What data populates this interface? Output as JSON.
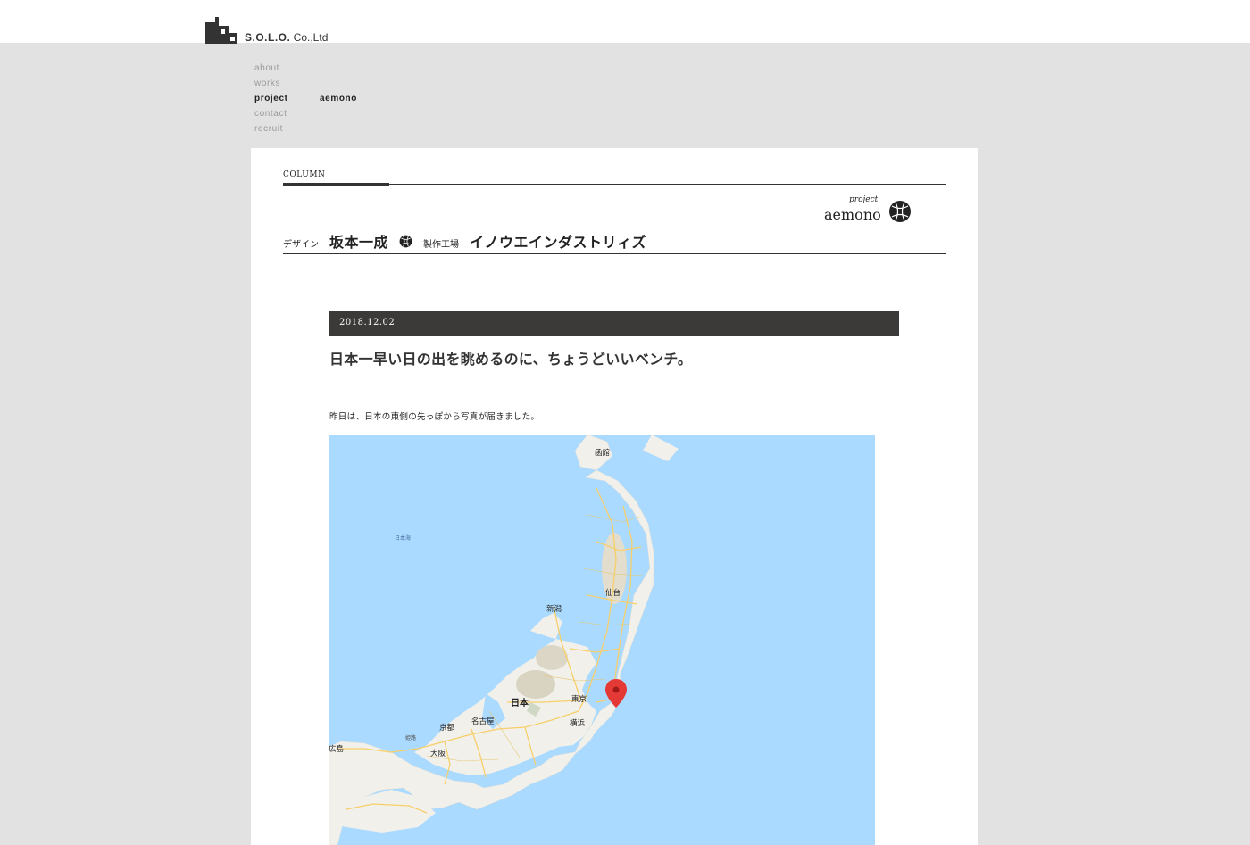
{
  "header": {
    "logo_text_bold": "S.O.L.O.",
    "logo_text_rest": " Co.,Ltd"
  },
  "nav": {
    "items": [
      {
        "label": "about"
      },
      {
        "label": "works"
      },
      {
        "label": "project"
      },
      {
        "label": "contact"
      },
      {
        "label": "recruit"
      }
    ],
    "active": "project",
    "sub_item": "aemono"
  },
  "column": {
    "label": "COLUMN",
    "brand_project": "project",
    "brand_name": "aemono",
    "design_label": "デザイン",
    "designer": "坂本一成",
    "factory_label": "製作工場",
    "factory": "イノウエインダストリィズ"
  },
  "post": {
    "date": "2018.12.02",
    "title": "日本一早い日の出を眺めるのに、ちょうどいいベンチ。",
    "body": "昨日は、日本の東側の先っぽから写真が届きました。"
  },
  "map": {
    "labels": {
      "hakodate": "函館",
      "sea_of_japan": "日本海",
      "sendai": "仙台",
      "niigata": "新潟",
      "japan": "日本",
      "tokyo": "東京",
      "yokohama": "横浜",
      "nagoya": "名古屋",
      "kyoto": "京都",
      "osaka": "大阪",
      "hiroshima": "広島",
      "himeji": "姫路"
    },
    "colors": {
      "sea": "#aadaff",
      "land": "#f2f0ea",
      "roads": "#f7cf6a",
      "marker": "#e53935"
    }
  }
}
